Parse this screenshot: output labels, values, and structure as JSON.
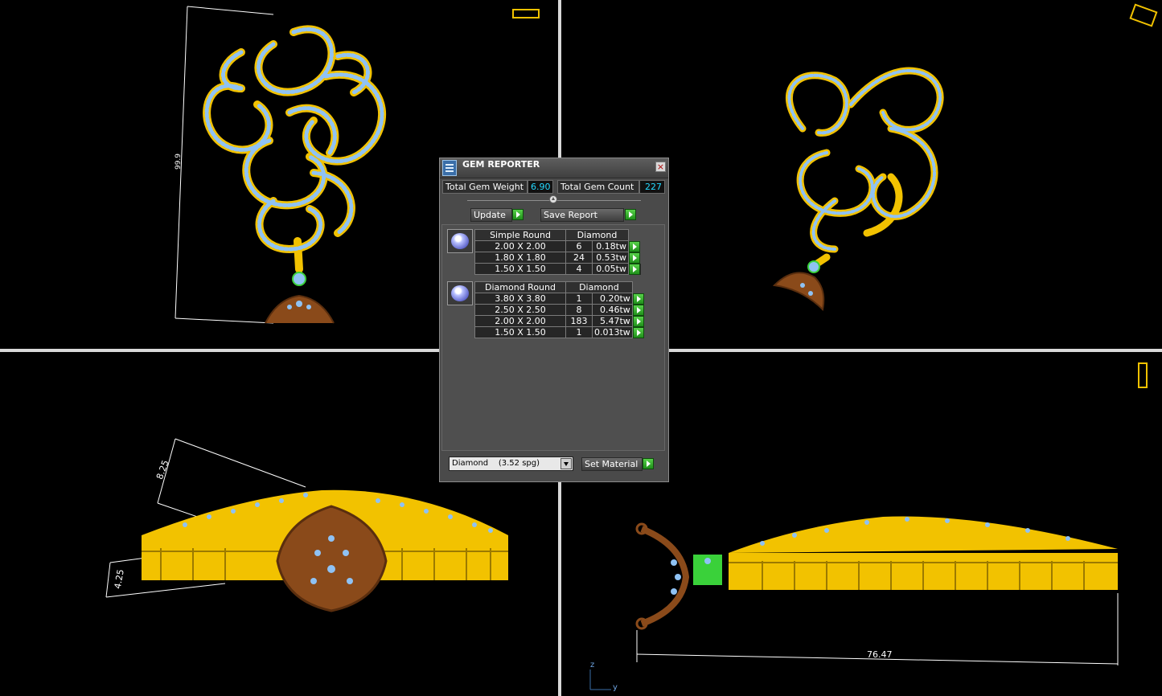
{
  "colors": {
    "gold": "#f2c200",
    "gem": "#8fc2f4",
    "bronze": "#8a4a1a",
    "accent_cyan": "#25d9ff",
    "go_green": "#2fb22a"
  },
  "viewports": {
    "top_left": {
      "dimension": "99.9"
    },
    "bottom_left": {
      "dimension_top": "8.25",
      "dimension_side": "4.25"
    },
    "bottom_right": {
      "dimension": "76.47",
      "axis_z": "z",
      "axis_y": "y"
    }
  },
  "gem_reporter": {
    "title": "GEM REPORTER",
    "total_weight_label": "Total Gem Weight",
    "total_weight_value": "6.90",
    "total_count_label": "Total Gem Count",
    "total_count_value": "227",
    "update_label": "Update",
    "save_report_label": "Save Report",
    "groups": [
      {
        "shape": "Simple Round",
        "material": "Diamond",
        "rows": [
          {
            "size": "2.00 X 2.00",
            "count": "6",
            "weight": "0.18tw"
          },
          {
            "size": "1.80 X 1.80",
            "count": "24",
            "weight": "0.53tw"
          },
          {
            "size": "1.50 X 1.50",
            "count": "4",
            "weight": "0.05tw"
          }
        ]
      },
      {
        "shape": "Diamond Round",
        "material": "Diamond",
        "rows": [
          {
            "size": "3.80 X 3.80",
            "count": "1",
            "weight": "0.20tw"
          },
          {
            "size": "2.50 X 2.50",
            "count": "8",
            "weight": "0.46tw"
          },
          {
            "size": "2.00 X 2.00",
            "count": "183",
            "weight": "5.47tw"
          },
          {
            "size": "1.50 X 1.50",
            "count": "1",
            "weight": "0.013tw"
          }
        ]
      }
    ],
    "material_select": "Diamond    (3.52 spg)",
    "set_material_label": "Set Material"
  }
}
